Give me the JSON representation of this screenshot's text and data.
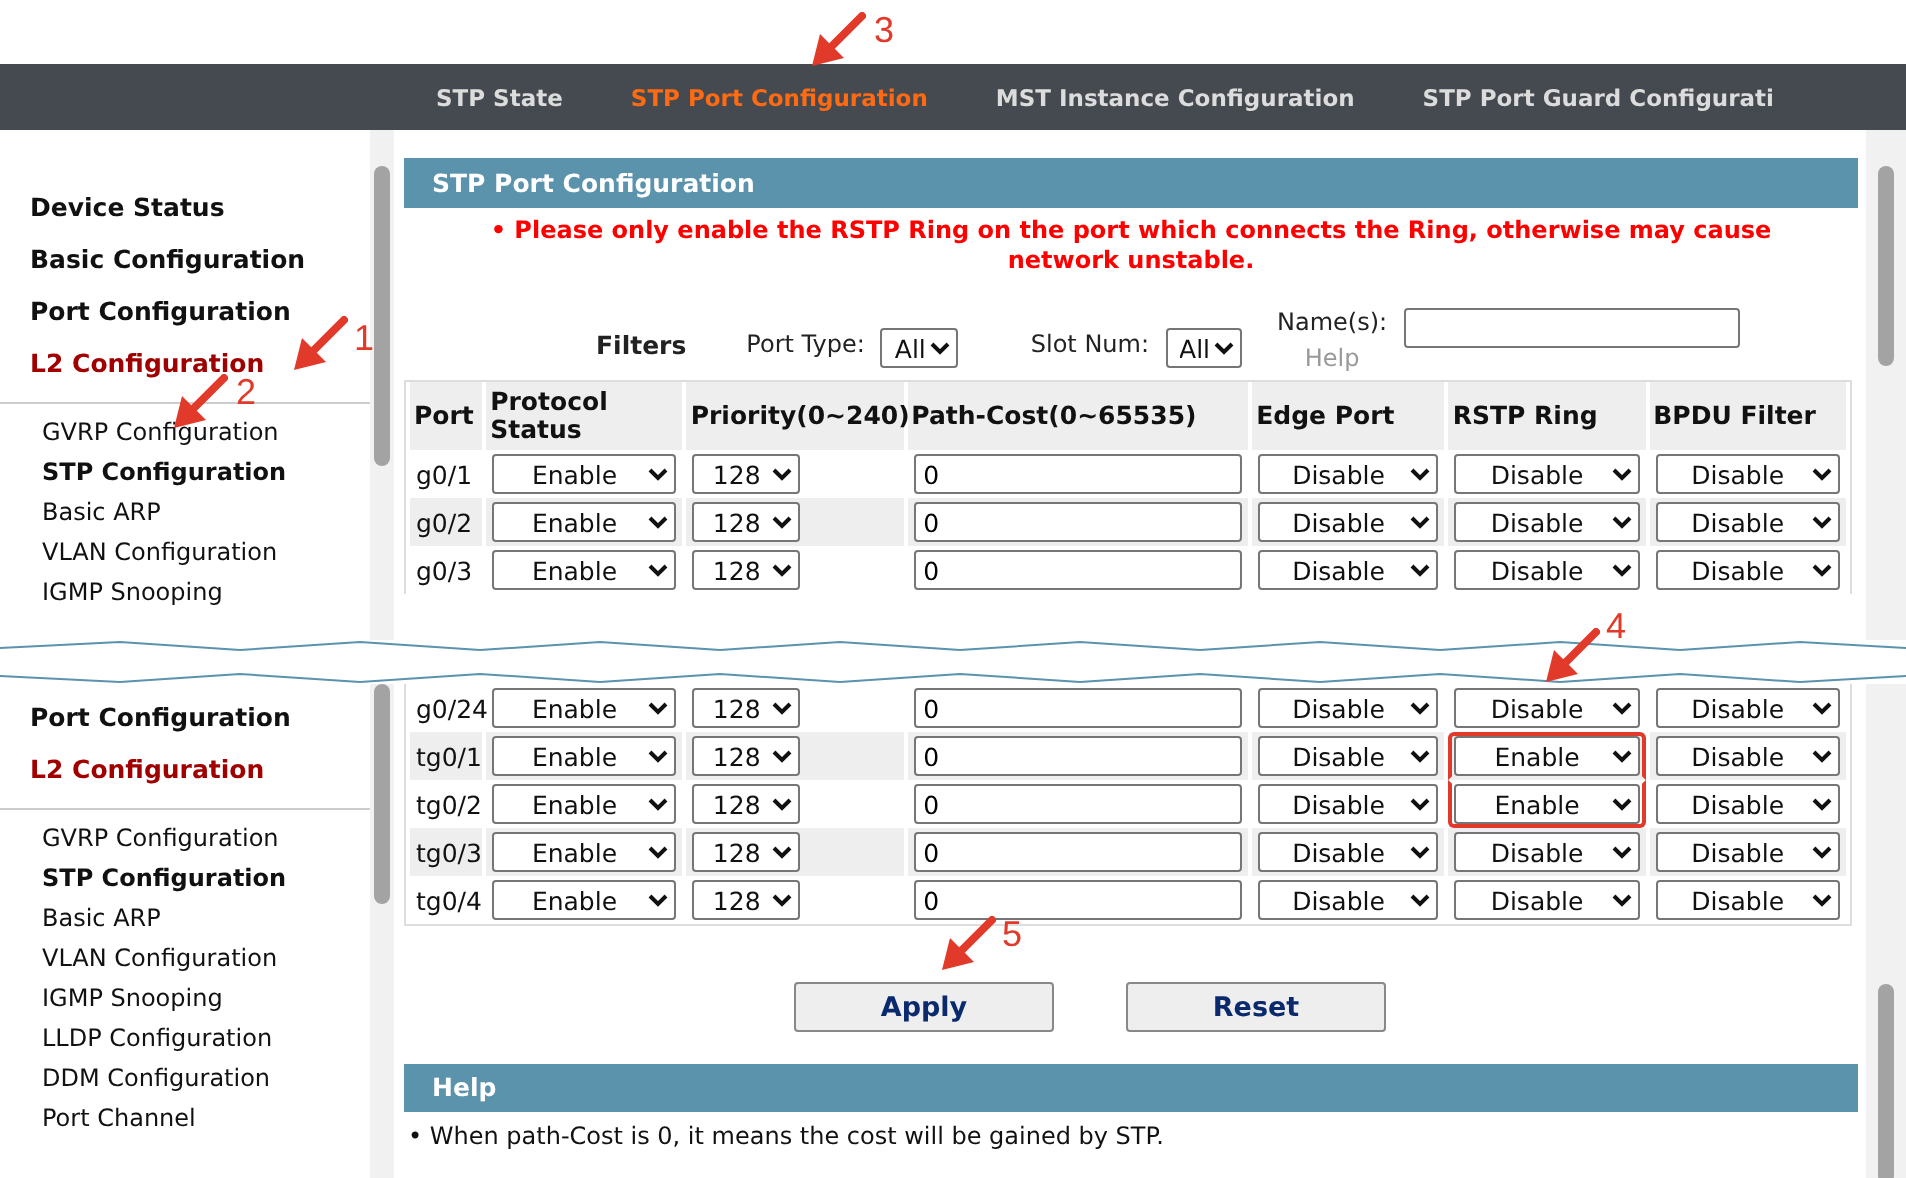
{
  "annotations": [
    {
      "label": "1"
    },
    {
      "label": "2"
    },
    {
      "label": "3"
    },
    {
      "label": "4"
    },
    {
      "label": "5"
    }
  ],
  "nav_tabs": [
    {
      "label": "STP State",
      "selected": false
    },
    {
      "label": "STP Port Configuration",
      "selected": true
    },
    {
      "label": "MST Instance Configuration",
      "selected": false
    },
    {
      "label": "STP Port Guard Configurati",
      "selected": false
    }
  ],
  "sidebar_top": {
    "items": [
      {
        "label": "Device Status",
        "selected": false
      },
      {
        "label": "Basic Configuration",
        "selected": false
      },
      {
        "label": "Port Configuration",
        "selected": false
      },
      {
        "label": "L2 Configuration",
        "selected": true
      }
    ],
    "subitems": [
      {
        "label": "GVRP Configuration",
        "selected": false
      },
      {
        "label": "STP Configuration",
        "selected": true
      },
      {
        "label": "Basic ARP",
        "selected": false
      },
      {
        "label": "VLAN Configuration",
        "selected": false
      },
      {
        "label": "IGMP Snooping",
        "selected": false
      }
    ]
  },
  "panel": {
    "title": "STP Port Configuration",
    "warning": "• Please only enable the RSTP Ring on the port which connects the Ring, otherwise may cause network unstable.",
    "filters": {
      "label": "Filters",
      "port_type": {
        "label": "Port Type:",
        "value": "All"
      },
      "slot_num": {
        "label": "Slot Num:",
        "value": "All"
      },
      "names": {
        "label": "Name(s):",
        "help": "Help"
      }
    }
  },
  "table": {
    "columns": [
      "Port",
      "Protocol Status",
      "Priority(0~240)",
      "Path-Cost(0~65535)",
      "Edge Port",
      "RSTP Ring",
      "BPDU Filter"
    ],
    "rows_top": [
      {
        "port": "g0/1",
        "protocol_status": "Enable",
        "priority": "128",
        "path_cost": "0",
        "edge_port": "Disable",
        "rstp_ring": "Disable",
        "bpdu_filter": "Disable",
        "highlighted": false
      },
      {
        "port": "g0/2",
        "protocol_status": "Enable",
        "priority": "128",
        "path_cost": "0",
        "edge_port": "Disable",
        "rstp_ring": "Disable",
        "bpdu_filter": "Disable",
        "highlighted": false
      },
      {
        "port": "g0/3",
        "protocol_status": "Enable",
        "priority": "128",
        "path_cost": "0",
        "edge_port": "Disable",
        "rstp_ring": "Disable",
        "bpdu_filter": "Disable",
        "highlighted": false
      }
    ],
    "rows_bottom": [
      {
        "port": "g0/24",
        "protocol_status": "Enable",
        "priority": "128",
        "path_cost": "0",
        "edge_port": "Disable",
        "rstp_ring": "Disable",
        "bpdu_filter": "Disable",
        "highlighted": false
      },
      {
        "port": "tg0/1",
        "protocol_status": "Enable",
        "priority": "128",
        "path_cost": "0",
        "edge_port": "Disable",
        "rstp_ring": "Enable",
        "bpdu_filter": "Disable",
        "highlighted": true
      },
      {
        "port": "tg0/2",
        "protocol_status": "Enable",
        "priority": "128",
        "path_cost": "0",
        "edge_port": "Disable",
        "rstp_ring": "Enable",
        "bpdu_filter": "Disable",
        "highlighted": true
      },
      {
        "port": "tg0/3",
        "protocol_status": "Enable",
        "priority": "128",
        "path_cost": "0",
        "edge_port": "Disable",
        "rstp_ring": "Disable",
        "bpdu_filter": "Disable",
        "highlighted": false
      },
      {
        "port": "tg0/4",
        "protocol_status": "Enable",
        "priority": "128",
        "path_cost": "0",
        "edge_port": "Disable",
        "rstp_ring": "Disable",
        "bpdu_filter": "Disable",
        "highlighted": false
      }
    ]
  },
  "sidebar_bottom": {
    "items": [
      {
        "label": "Port Configuration",
        "selected": false
      },
      {
        "label": "L2 Configuration",
        "selected": true
      }
    ],
    "subitems": [
      {
        "label": "GVRP Configuration",
        "selected": false
      },
      {
        "label": "STP Configuration",
        "selected": true
      },
      {
        "label": "Basic ARP",
        "selected": false
      },
      {
        "label": "VLAN Configuration",
        "selected": false
      },
      {
        "label": "IGMP Snooping",
        "selected": false
      },
      {
        "label": "LLDP Configuration",
        "selected": false
      },
      {
        "label": "DDM Configuration",
        "selected": false
      },
      {
        "label": "Port Channel",
        "selected": false
      }
    ]
  },
  "buttons": [
    {
      "label": "Apply"
    },
    {
      "label": "Reset"
    }
  ],
  "help": {
    "title": "Help",
    "text": "• When path-Cost is 0, it means the cost will be gained by STP."
  }
}
